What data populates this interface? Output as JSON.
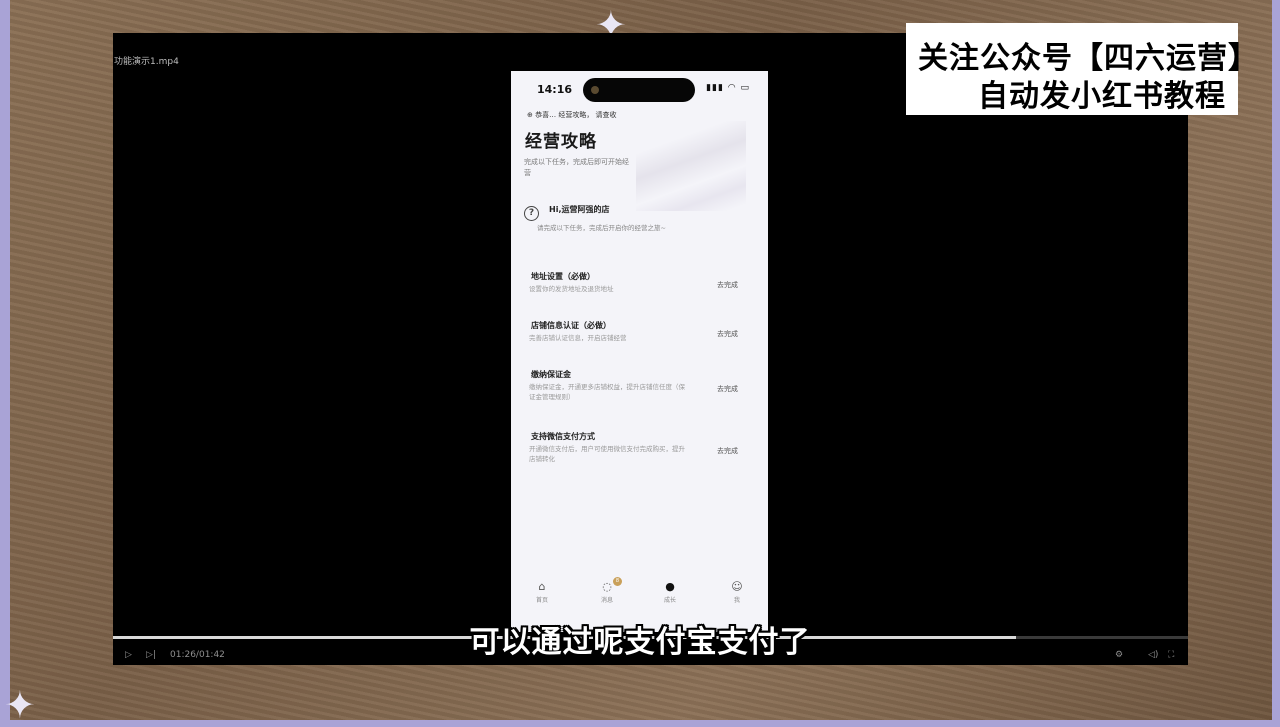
{
  "player": {
    "file_name": "功能演示1.mp4",
    "time_display": "01:26/01:42",
    "progress": 0.84
  },
  "overlay": {
    "title_line1": "关注公众号【四六运营】",
    "title_line2": "自动发小红书教程"
  },
  "subtitle": "可以通过呢支付宝支付了",
  "phone": {
    "status": {
      "time": "14:16",
      "icons": "▮▮▮ ◠ ▭"
    },
    "notice": "⊕ 恭喜… 经营攻略， 请查收",
    "page_title": "经营攻略",
    "page_desc": "完成以下任务，完成后即可开始经营",
    "greeting": {
      "title": "Hi,运营阿强的店",
      "subtitle": "请完成以下任务，完成后开启你的经营之旅~"
    },
    "tasks": [
      {
        "title": "地址设置（必做）",
        "desc": "设置你的发货地址及退货地址",
        "link": "去完成"
      },
      {
        "title": "店铺信息认证（必做）",
        "desc": "完善店铺认证信息，开启店铺经营",
        "link": "去完成"
      },
      {
        "title": "缴纳保证金",
        "desc": "缴纳保证金，开通更多店铺权益，提升店铺信任度（保证金管理规则）",
        "link": "去完成"
      },
      {
        "title": "支持微信支付方式",
        "desc": "开通微信支付后，用户可使用微信支付完成购买，提升店铺转化",
        "link": "去完成"
      }
    ],
    "tabbar": [
      {
        "label": "首页",
        "icon": "home-icon"
      },
      {
        "label": "消息",
        "icon": "message-icon",
        "badge": "8"
      },
      {
        "label": "成长",
        "icon": "growth-icon"
      },
      {
        "label": "我",
        "icon": "profile-icon"
      }
    ]
  }
}
